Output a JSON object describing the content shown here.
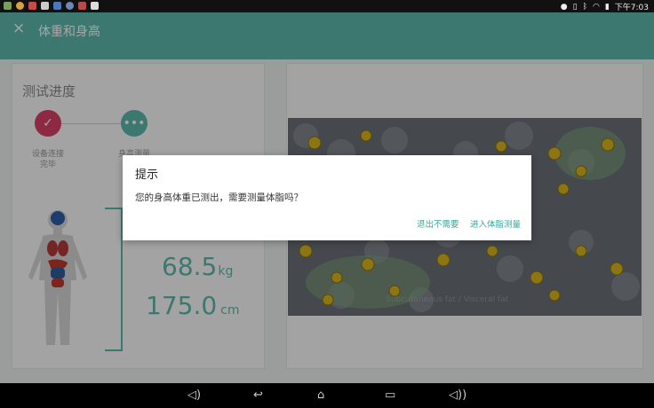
{
  "status_bar": {
    "time": "下午7:03"
  },
  "app_bar": {
    "close_glyph": "×",
    "title": "体重和身高"
  },
  "progress": {
    "title": "测试进度",
    "steps": [
      {
        "label_line1": "设备连接",
        "label_line2": "完毕",
        "icon": "check-icon"
      },
      {
        "label_line1": "身高测量",
        "label_line2": "",
        "icon": "more-icon"
      }
    ]
  },
  "measurements": {
    "weight_value": "68.5",
    "weight_unit": "kg",
    "height_value": "175.0",
    "height_unit": "cm"
  },
  "video": {
    "caption": "Subcutaneous fat / Visceral fat"
  },
  "dialog": {
    "title": "提示",
    "message": "您的身高体重已测出，需要测量体脂吗？",
    "button_no": "退出不需要",
    "button_yes": "进入体脂测量"
  },
  "nav": {
    "icons": [
      "volume-down-icon",
      "back-icon",
      "home-icon",
      "recents-icon",
      "volume-up-icon"
    ]
  },
  "colors": {
    "accent": "#5eb8ad",
    "step_done": "#d94067"
  }
}
